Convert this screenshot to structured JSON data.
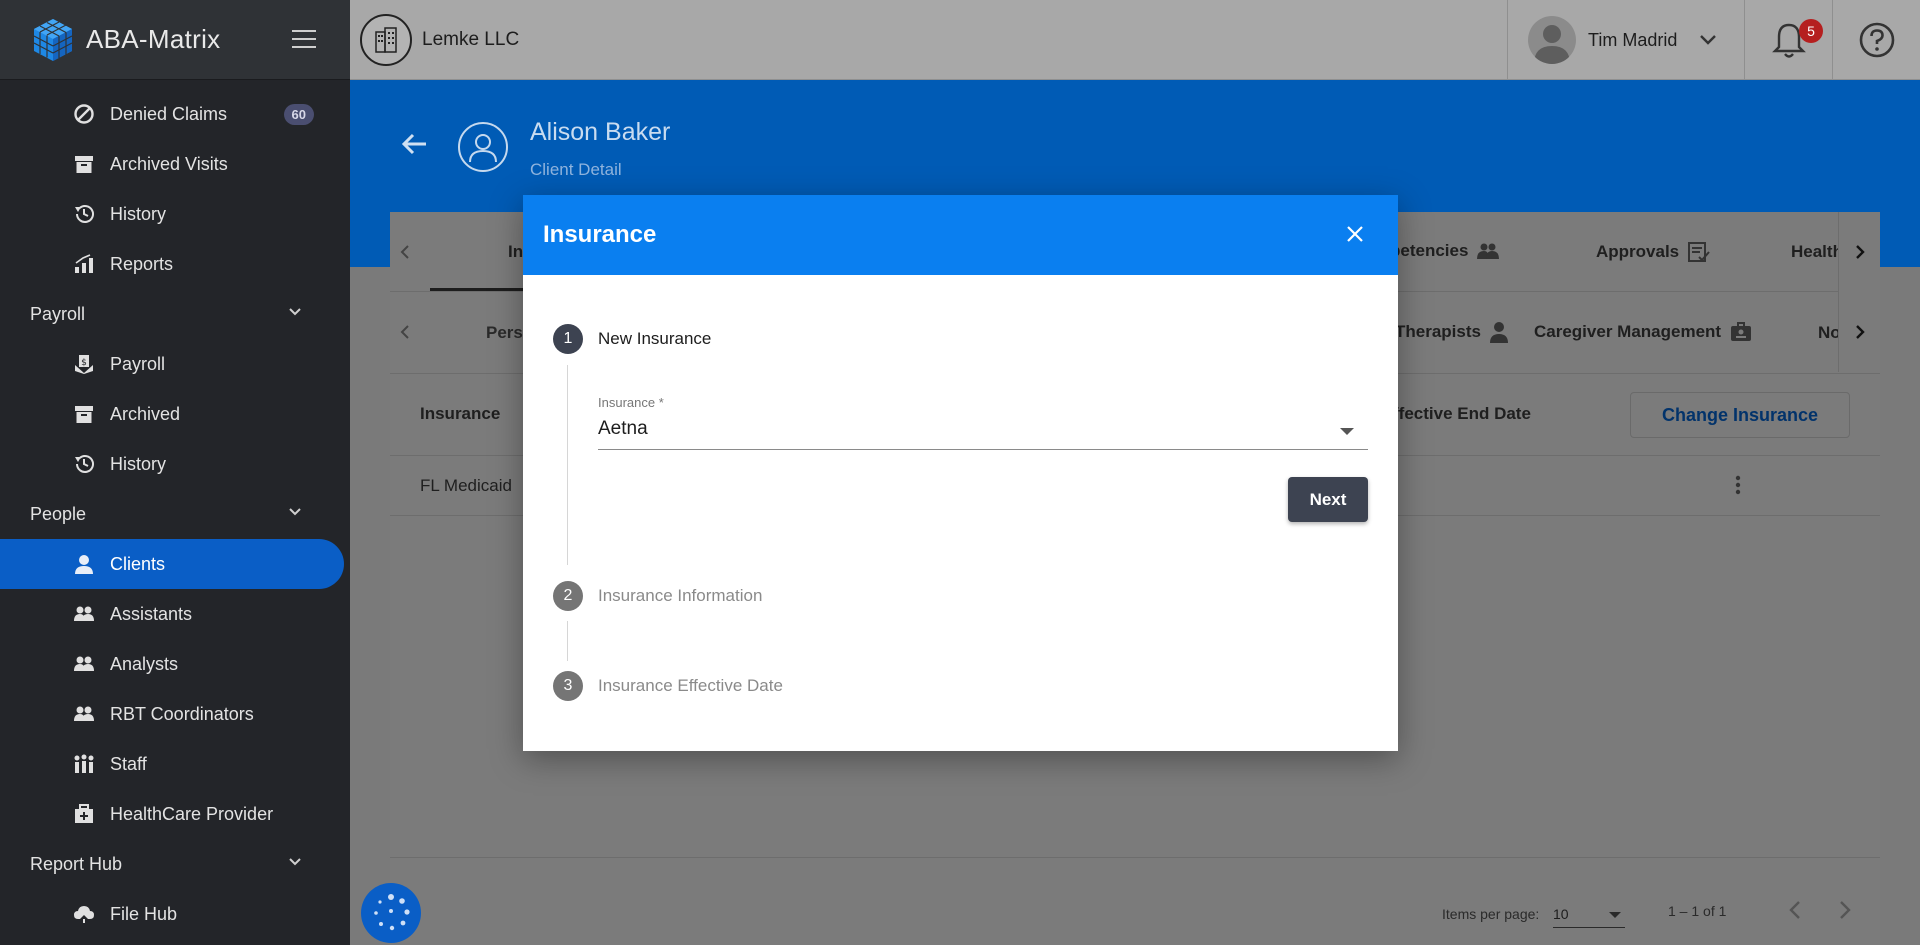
{
  "app": {
    "name": "ABA-Matrix"
  },
  "sidebar": {
    "items": [
      {
        "label": "Denied Claims",
        "icon": "block-icon",
        "badge": "60"
      },
      {
        "label": "Archived Visits",
        "icon": "archive-icon"
      },
      {
        "label": "History",
        "icon": "history-icon"
      },
      {
        "label": "Reports",
        "icon": "bar-chart-icon"
      }
    ],
    "payroll": {
      "title": "Payroll",
      "items": [
        {
          "label": "Payroll",
          "icon": "payroll-icon"
        },
        {
          "label": "Archived",
          "icon": "archive-icon"
        },
        {
          "label": "History",
          "icon": "history-icon"
        }
      ]
    },
    "people": {
      "title": "People",
      "items": [
        {
          "label": "Clients",
          "icon": "person-icon"
        },
        {
          "label": "Assistants",
          "icon": "group-icon"
        },
        {
          "label": "Analysts",
          "icon": "group-icon"
        },
        {
          "label": "RBT Coordinators",
          "icon": "group-icon"
        },
        {
          "label": "Staff",
          "icon": "staff-icon"
        },
        {
          "label": "HealthCare Provider",
          "icon": "medical-kit-icon"
        }
      ]
    },
    "report_hub": {
      "title": "Report Hub",
      "items": [
        {
          "label": "File Hub",
          "icon": "cloud-icon"
        }
      ]
    }
  },
  "topbar": {
    "org_name": "Lemke LLC",
    "user_name": "Tim Madrid",
    "notification_count": "5"
  },
  "client": {
    "name": "Alison Baker",
    "subtitle": "Client Detail"
  },
  "tabs_row1": {
    "first_partial": "In",
    "competencies_partial": "petencies",
    "approvals": "Approvals",
    "health_partial": "Health"
  },
  "tabs_row2": {
    "first_partial": "Perso",
    "therapists_partial": "Therapists",
    "caregiver": "Caregiver Management",
    "notes_partial": "No"
  },
  "table": {
    "col_insurance": "Insurance",
    "col_end_date_partial": "ffective End Date",
    "change_button": "Change Insurance",
    "rows": [
      {
        "insurance": "FL Medicaid"
      }
    ]
  },
  "paginator": {
    "items_per_page_label": "Items per page:",
    "page_size": "10",
    "range": "1 – 1 of 1"
  },
  "modal": {
    "title": "Insurance",
    "steps": [
      {
        "number": "1",
        "label": "New Insurance"
      },
      {
        "number": "2",
        "label": "Insurance Information"
      },
      {
        "number": "3",
        "label": "Insurance Effective Date"
      }
    ],
    "field_label": "Insurance *",
    "field_value": "Aetna",
    "next_button": "Next"
  },
  "colors": {
    "accent": "#0a7ff0",
    "sidebar_bg": "#232529",
    "active_nav": "#0a5ec6",
    "step_active": "#3d4351",
    "notification_badge": "#b51f1f"
  }
}
